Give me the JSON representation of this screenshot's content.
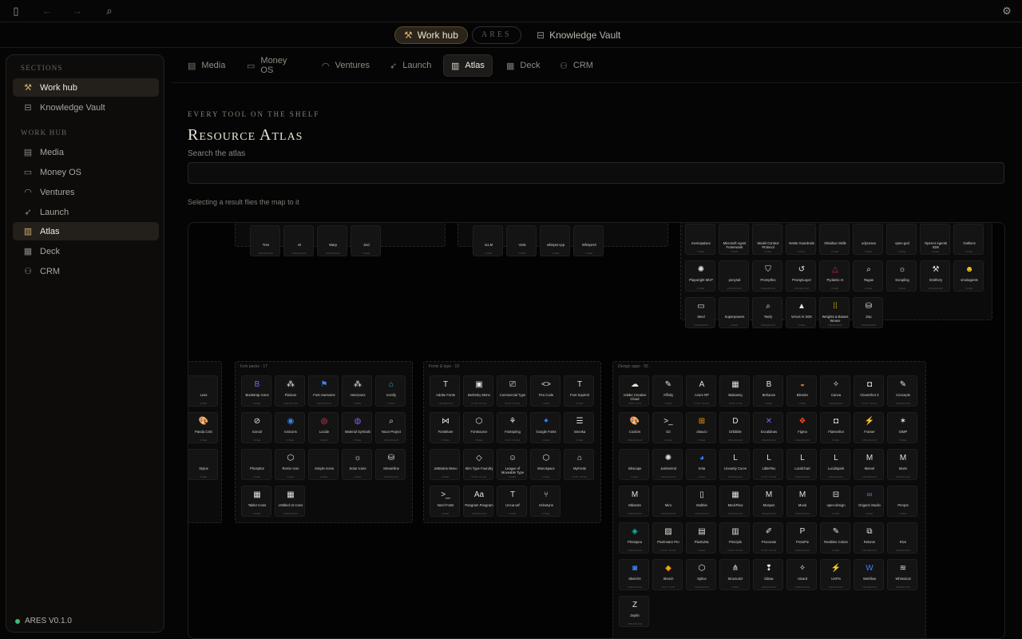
{
  "topbar": {
    "sidebar_toggle_icon": "sidebar-toggle-icon",
    "back_icon": "arrow-left-icon",
    "forward_icon": "arrow-right-icon",
    "search_icon": "search-icon",
    "settings_icon": "gear-icon"
  },
  "pillbar": {
    "work_hub": "Work hub",
    "ares": "ARES",
    "knowledge_vault": "Knowledge Vault"
  },
  "sidebar": {
    "sections_heading": "Sections",
    "sections": [
      {
        "label": "Work hub",
        "icon": "wrench-icon",
        "active": true
      },
      {
        "label": "Knowledge Vault",
        "icon": "vault-icon",
        "active": false
      }
    ],
    "workhub_heading": "Work hub",
    "items": [
      {
        "label": "Media",
        "icon": "film-icon",
        "active": false
      },
      {
        "label": "Money OS",
        "icon": "wallet-icon",
        "active": false
      },
      {
        "label": "Ventures",
        "icon": "gauge-icon",
        "active": false
      },
      {
        "label": "Launch",
        "icon": "rocket-icon",
        "active": false
      },
      {
        "label": "Atlas",
        "icon": "map-icon",
        "active": true
      },
      {
        "label": "Deck",
        "icon": "grid-icon",
        "active": false
      },
      {
        "label": "CRM",
        "icon": "users-icon",
        "active": false
      }
    ],
    "version": "ARES V0.1.0"
  },
  "tabs": [
    {
      "label": "Media",
      "icon": "film-icon"
    },
    {
      "label": "Money OS",
      "icon": "wallet-icon"
    },
    {
      "label": "Ventures",
      "icon": "gauge-icon"
    },
    {
      "label": "Launch",
      "icon": "rocket-icon"
    },
    {
      "label": "Atlas",
      "icon": "map-icon",
      "active": true
    },
    {
      "label": "Deck",
      "icon": "grid-icon"
    },
    {
      "label": "CRM",
      "icon": "users-icon"
    }
  ],
  "atlas": {
    "eyebrow": "EVERY TOOL ON THE SHELF",
    "title": "Resource Atlas",
    "search_label": "Search the atlas",
    "search_value": "",
    "hint": "Selecting a result flies the map to it"
  },
  "map": {
    "panels": [
      {
        "title": "",
        "tiles": [
          {
            "name": "Tree",
            "sub": "FREEMIUM",
            "glyph": ""
          },
          {
            "name": "v0",
            "sub": "FREEMIUM",
            "glyph": ""
          },
          {
            "name": "Warp",
            "sub": "FREEMIUM",
            "glyph": ""
          },
          {
            "name": "Zed",
            "sub": "FREE",
            "glyph": ""
          }
        ]
      },
      {
        "title": "",
        "tiles": [
          {
            "name": "vLLM",
            "sub": "FREE",
            "glyph": ""
          },
          {
            "name": "Vosk",
            "sub": "FREE",
            "glyph": ""
          },
          {
            "name": "whisper.cpp",
            "sub": "FREE",
            "glyph": ""
          },
          {
            "name": "WhisperX",
            "sub": "FREE",
            "glyph": ""
          }
        ]
      },
      {
        "title": "",
        "tiles": [
          {
            "name": "memopalace",
            "sub": "FREE",
            "glyph": ""
          },
          {
            "name": "Microsoft Agent Framework",
            "sub": "FREE",
            "glyph": ""
          },
          {
            "name": "Model Context Protocol",
            "sub": "FREE",
            "glyph": ""
          },
          {
            "name": "NeMo Guardrails",
            "sub": "FREE",
            "glyph": ""
          },
          {
            "name": "Obsidian Skills",
            "sub": "FREE",
            "glyph": ""
          },
          {
            "name": "odyceaus",
            "sub": "FREE",
            "glyph": ""
          },
          {
            "name": "open-god",
            "sub": "FREE",
            "glyph": ""
          },
          {
            "name": "OpenAI Agents SDK",
            "sub": "FREE",
            "glyph": ""
          },
          {
            "name": "Outlines",
            "sub": "FREE",
            "glyph": ""
          },
          {
            "name": "Playwright MCP",
            "sub": "FREE",
            "glyph": "✺"
          },
          {
            "name": "ponyrail",
            "sub": "FREEMIUM",
            "glyph": ""
          },
          {
            "name": "Promptfoo",
            "sub": "FREEMIUM",
            "glyph": "⛉"
          },
          {
            "name": "PromptLayer",
            "sub": "FREEMIUM",
            "glyph": "↺"
          },
          {
            "name": "Pydantic AI",
            "sub": "FREE",
            "glyph": "△"
          },
          {
            "name": "Ragas",
            "sub": "FREE",
            "glyph": "⌕"
          },
          {
            "name": "Scrapling",
            "sub": "FREE",
            "glyph": "☼"
          },
          {
            "name": "Smithery",
            "sub": "FREEMIUM",
            "glyph": "⚒"
          },
          {
            "name": "smolagents",
            "sub": "FREE",
            "glyph": "☻"
          },
          {
            "name": "Steel",
            "sub": "FREEMIUM",
            "glyph": "▭"
          },
          {
            "name": "Superpowers",
            "sub": "FREE",
            "glyph": ""
          },
          {
            "name": "Tavily",
            "sub": "FREEMIUM",
            "glyph": "⌕"
          },
          {
            "name": "Vercel AI SDK",
            "sub": "FREE",
            "glyph": "▲"
          },
          {
            "name": "Weights & Biases Weave",
            "sub": "FREEMIUM",
            "glyph": "⁞⁞"
          },
          {
            "name": "Zep",
            "sub": "FREEMIUM",
            "glyph": "⛁"
          }
        ]
      },
      {
        "title": "",
        "tiles": [
          {
            "name": "Less",
            "sub": "FREE",
            "glyph": ""
          },
          {
            "name": "Panda CSS",
            "sub": "FREE",
            "glyph": "🎨"
          },
          {
            "name": "Stylus",
            "sub": "FREE",
            "glyph": ""
          }
        ]
      },
      {
        "title": "Icon packs · 17",
        "tiles": [
          {
            "name": "Bootstrap Icons",
            "sub": "FREE",
            "glyph": "B"
          },
          {
            "name": "Flaticon",
            "sub": "FREEMIUM",
            "glyph": "⁂"
          },
          {
            "name": "Font Awesome",
            "sub": "FREEMIUM",
            "glyph": "⚑"
          },
          {
            "name": "Heroicons",
            "sub": "FREE",
            "glyph": "⁂"
          },
          {
            "name": "Iconify",
            "sub": "FREE",
            "glyph": "⌂"
          },
          {
            "name": "Iconoir",
            "sub": "FREE",
            "glyph": "⊘"
          },
          {
            "name": "Ionicons",
            "sub": "FREE",
            "glyph": "◉"
          },
          {
            "name": "Lucide",
            "sub": "FREE",
            "glyph": "◎"
          },
          {
            "name": "Material Symbols",
            "sub": "FREE",
            "glyph": "◍"
          },
          {
            "name": "Noun Project",
            "sub": "FREEMIUM",
            "glyph": "⌕"
          },
          {
            "name": "Phosphor",
            "sub": "FREE",
            "glyph": ""
          },
          {
            "name": "Remix Icon",
            "sub": "FREE",
            "glyph": "⬡"
          },
          {
            "name": "Simple Icons",
            "sub": "FREE",
            "glyph": ""
          },
          {
            "name": "Solar Icons",
            "sub": "FREE",
            "glyph": "☼"
          },
          {
            "name": "Streamline",
            "sub": "FREEMIUM",
            "glyph": "⛁"
          },
          {
            "name": "Tabler Icons",
            "sub": "FREE",
            "glyph": "▦"
          },
          {
            "name": "Untitled UI Icons",
            "sub": "FREEMIUM",
            "glyph": "▦"
          }
        ]
      },
      {
        "title": "Fonts & type · 19",
        "tiles": [
          {
            "name": "Adobe Fonts",
            "sub": "FREEMIUM",
            "glyph": "T"
          },
          {
            "name": "Berkeley Mono",
            "sub": "PAID ONCE",
            "glyph": "▣"
          },
          {
            "name": "Commercial Type",
            "sub": "PAID ONCE",
            "glyph": "⎚"
          },
          {
            "name": "Fira Code",
            "sub": "FREE",
            "glyph": "<>"
          },
          {
            "name": "Font Squirrel",
            "sub": "FREE",
            "glyph": "T"
          },
          {
            "name": "Fontshare",
            "sub": "FREE",
            "glyph": "⋈"
          },
          {
            "name": "Fontsource",
            "sub": "FREE",
            "glyph": "⬡"
          },
          {
            "name": "Fontspring",
            "sub": "PAID ONCE",
            "glyph": "⚘"
          },
          {
            "name": "Google Fonts",
            "sub": "FREE",
            "glyph": "✦"
          },
          {
            "name": "Iosevka",
            "sub": "FREE",
            "glyph": "☰"
          },
          {
            "name": "JetBrains Mono",
            "sub": "FREE",
            "glyph": ""
          },
          {
            "name": "Klim Type Foundry",
            "sub": "PAID ONCE",
            "glyph": "◇"
          },
          {
            "name": "League of Moveable Type",
            "sub": "FREE",
            "glyph": "☺"
          },
          {
            "name": "Monospace",
            "sub": "FREE",
            "glyph": "⬡"
          },
          {
            "name": "MyFonts",
            "sub": "PAID ONCE",
            "glyph": "⌂"
          },
          {
            "name": "Nerd Fonts",
            "sub": "FREE",
            "glyph": ">_"
          },
          {
            "name": "Pangram Pangram",
            "sub": "FREEMIUM",
            "glyph": "Aa"
          },
          {
            "name": "Uncut.wtf",
            "sub": "FREE",
            "glyph": "T"
          },
          {
            "name": "Velvetyne",
            "sub": "FREE",
            "glyph": "⑂"
          }
        ]
      },
      {
        "title": "Design apps · 55",
        "tiles": [
          {
            "name": "Adobe Creative Cloud",
            "sub": "PAID SUB",
            "glyph": "☁"
          },
          {
            "name": "Affinity",
            "sub": "FREE",
            "glyph": "✎"
          },
          {
            "name": "Azure RP",
            "sub": "PAID ONCE",
            "glyph": "A"
          },
          {
            "name": "Balsamiq",
            "sub": "PAID SUB",
            "glyph": "▦"
          },
          {
            "name": "Behance",
            "sub": "FREE",
            "glyph": "B"
          },
          {
            "name": "Blender",
            "sub": "FREE",
            "glyph": "◒"
          },
          {
            "name": "Canva",
            "sub": "FREEMIUM",
            "glyph": "✧"
          },
          {
            "name": "CleanShot X",
            "sub": "PAID ONCE",
            "glyph": "◘"
          },
          {
            "name": "Concepts",
            "sub": "FREEMIUM",
            "glyph": "✎"
          },
          {
            "name": "Coolors",
            "sub": "FREEMIUM",
            "glyph": "🎨"
          },
          {
            "name": "D2",
            "sub": "FREE",
            "glyph": ">_"
          },
          {
            "name": "draw.io",
            "sub": "FREE",
            "glyph": "⊞"
          },
          {
            "name": "Dribbble",
            "sub": "FREEMIUM",
            "glyph": "D"
          },
          {
            "name": "Excalidraw",
            "sub": "FREEMIUM",
            "glyph": "✕"
          },
          {
            "name": "Figma",
            "sub": "FREEMIUM",
            "glyph": "❖"
          },
          {
            "name": "Flameshot",
            "sub": "FREE",
            "glyph": "◘"
          },
          {
            "name": "Framer",
            "sub": "FREEMIUM",
            "glyph": "⚡"
          },
          {
            "name": "GIMP",
            "sub": "FREE",
            "glyph": "✶"
          },
          {
            "name": "Inkscape",
            "sub": "FREE",
            "glyph": ""
          },
          {
            "name": "Justinmind",
            "sub": "FREEMIUM",
            "glyph": "✺"
          },
          {
            "name": "Krita",
            "sub": "FREE",
            "glyph": "◕"
          },
          {
            "name": "Linearity Curve",
            "sub": "FREEMIUM",
            "glyph": "L"
          },
          {
            "name": "LittleFlex",
            "sub": "PAID ONCE",
            "glyph": "L"
          },
          {
            "name": "Lucidchart",
            "sub": "FREEMIUM",
            "glyph": "L"
          },
          {
            "name": "Lucidspark",
            "sub": "FREEMIUM",
            "glyph": "L"
          },
          {
            "name": "Marvel",
            "sub": "FREEMIUM",
            "glyph": "M"
          },
          {
            "name": "Maze",
            "sub": "FREEMIUM",
            "glyph": "M"
          },
          {
            "name": "Milanote",
            "sub": "FREEMIUM",
            "glyph": "M"
          },
          {
            "name": "Miro",
            "sub": "FREEMIUM",
            "glyph": ""
          },
          {
            "name": "Mobbin",
            "sub": "FREEMIUM",
            "glyph": "▯"
          },
          {
            "name": "MockFlow",
            "sub": "FREEMIUM",
            "glyph": "▦"
          },
          {
            "name": "Mospos",
            "sub": "FREEMIUM",
            "glyph": "M"
          },
          {
            "name": "Mural",
            "sub": "FREEMIUM",
            "glyph": "M"
          },
          {
            "name": "open-design",
            "sub": "FREE",
            "glyph": "⊟"
          },
          {
            "name": "Origami Studio",
            "sub": "FREE",
            "glyph": "∞"
          },
          {
            "name": "Penpot",
            "sub": "FREE",
            "glyph": ""
          },
          {
            "name": "Photopea",
            "sub": "FREEMIUM",
            "glyph": "◈"
          },
          {
            "name": "Pixelmator Pro",
            "sub": "PAID ONCE",
            "glyph": "▨"
          },
          {
            "name": "PlantUML",
            "sub": "FREE",
            "glyph": "▤"
          },
          {
            "name": "Principle",
            "sub": "PAID ONCE",
            "glyph": "▥"
          },
          {
            "name": "Procreate",
            "sub": "PAID ONCE",
            "glyph": "✐"
          },
          {
            "name": "ProtoPie",
            "sub": "FREEMIUM",
            "glyph": "P"
          },
          {
            "name": "Realtime Colors",
            "sub": "FREE",
            "glyph": "✎"
          },
          {
            "name": "Relume",
            "sub": "FREEMIUM",
            "glyph": "⧉"
          },
          {
            "name": "Rive",
            "sub": "FREEMIUM",
            "glyph": ""
          },
          {
            "name": "SketchX",
            "sub": "FREEMIUM",
            "glyph": "◙"
          },
          {
            "name": "Sketch",
            "sub": "PAID SUB",
            "glyph": "◆"
          },
          {
            "name": "Spline",
            "sub": "FREEMIUM",
            "glyph": "⬡"
          },
          {
            "name": "Structurizr",
            "sub": "FREE",
            "glyph": "⋔"
          },
          {
            "name": "tldraw",
            "sub": "FREEMIUM",
            "glyph": "❢"
          },
          {
            "name": "Uizard",
            "sub": "FREEMIUM",
            "glyph": "✧"
          },
          {
            "name": "UXPin",
            "sub": "FREEMIUM",
            "glyph": "⚡"
          },
          {
            "name": "Webflow",
            "sub": "FREEMIUM",
            "glyph": "W"
          },
          {
            "name": "Whimsical",
            "sub": "FREEMIUM",
            "glyph": "≋"
          },
          {
            "name": "Zeplin",
            "sub": "FREEMIUM",
            "glyph": "Z"
          }
        ]
      }
    ]
  }
}
